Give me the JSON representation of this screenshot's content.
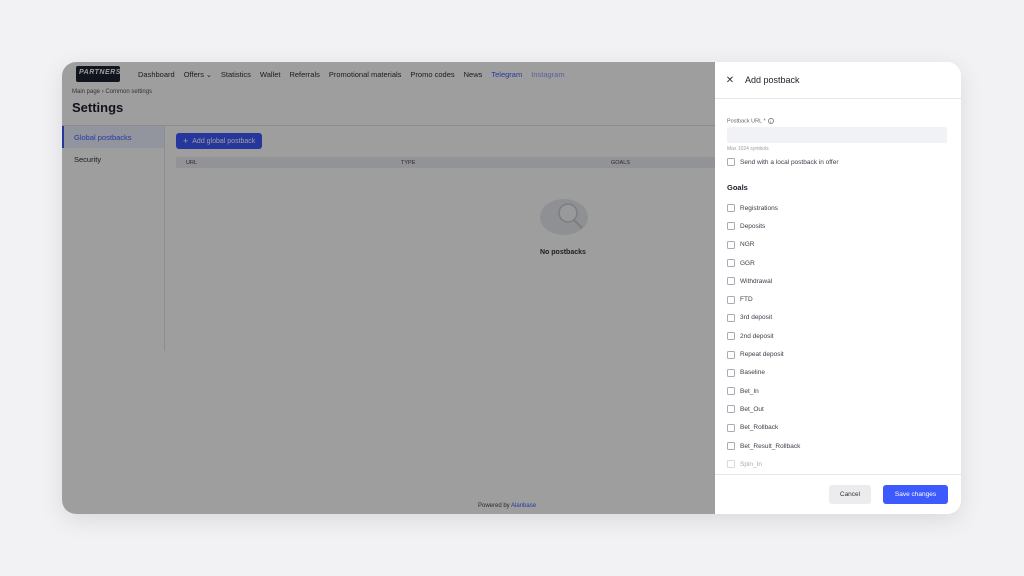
{
  "nav": {
    "logo_text": "PARTNERS",
    "items": [
      "Dashboard",
      "Offers",
      "Statistics",
      "Wallet",
      "Referrals",
      "Promotional materials",
      "Promo codes",
      "News"
    ],
    "links": [
      "Telegram",
      "Instagram"
    ]
  },
  "breadcrumb": {
    "home": "Main page",
    "current": "Common settings"
  },
  "page_title": "Settings",
  "sidebar": {
    "items": [
      "Global postbacks",
      "Security"
    ]
  },
  "main": {
    "add_button": "Add global postback",
    "columns": [
      "URL",
      "TYPE",
      "GOALS"
    ],
    "empty_text": "No postbacks"
  },
  "footer": {
    "prefix": "Powered by",
    "brand": "Alanbase"
  },
  "drawer": {
    "title": "Add postback",
    "close_icon": "close-icon",
    "postback_url_label": "Postback URL *",
    "postback_url_value": "",
    "hint": "Max 1024 symbols",
    "local_postback_label": "Send with a local postback in offer",
    "goals_title": "Goals",
    "goals": [
      "Registrations",
      "Deposits",
      "NGR",
      "GGR",
      "Withdrawal",
      "FTD",
      "3rd deposit",
      "2nd deposit",
      "Repeat deposit",
      "Baseline",
      "Bet_In",
      "Bet_Out",
      "Bet_Rollback",
      "Bet_Result_Rollback",
      "Spin_In"
    ],
    "cancel": "Cancel",
    "save": "Save changes"
  },
  "colors": {
    "accent": "#3d5afe",
    "overlay": "rgba(0,0,0,0.38)"
  }
}
